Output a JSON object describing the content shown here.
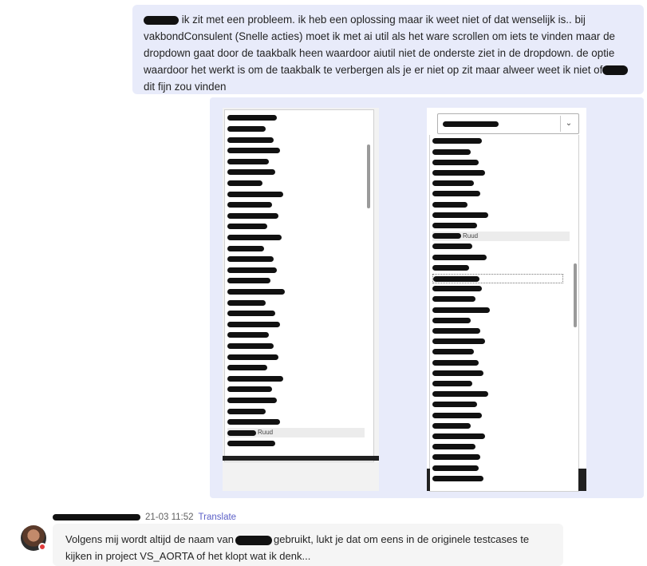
{
  "outgoing_message": {
    "text_1": "ik zit met een probleem. ik heb een oplossing maar ik weet niet of dat wenselijk is.. bij vakbondConsulent (Snelle acties) moet ik met ai util als het ware scrollen om iets te vinden maar de dropdown gaat door de taakbalk heen waardoor aiutil niet de onderste ziet in de dropdown. de optie waardoor het werkt is om de taakbalk te verbergen als je er niet op zit maar alweer weet ik niet of",
    "text_2": "dit fijn zou vinden"
  },
  "screenshot_left": {
    "selected_item": "Ruud",
    "selected_index": 29,
    "item_count": 31,
    "scroll_position": 0.12
  },
  "screenshot_right": {
    "combo_chevron": "⌄",
    "selected_item": "Ruud",
    "selected_index": 9,
    "focused_index": 13,
    "item_count": 33,
    "scroll_position": 0.44
  },
  "incoming_message": {
    "time": "21-03 11:52",
    "translate_label": "Translate",
    "text_1": "Volgens mij wordt altijd de naam van",
    "text_2": "gebruikt, lukt je dat om eens in de originele testcases te kijken in project VS_AORTA of het klopt wat ik denk...",
    "presence_color": "#e23b3b"
  },
  "colors": {
    "outgoing_bubble": "#e8ebfa",
    "incoming_bubble": "#f5f5f5",
    "link": "#5b5fc7",
    "redaction": "#111111"
  }
}
